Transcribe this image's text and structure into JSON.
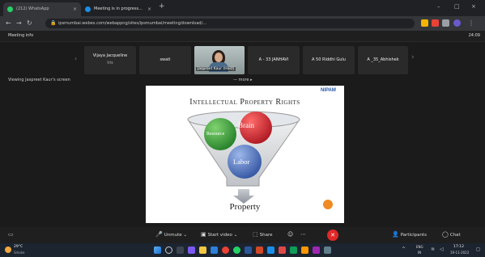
{
  "browser": {
    "tabs": [
      {
        "title": "(212) WhatsApp",
        "close": "×"
      },
      {
        "title": "Meeting is in progress...",
        "close": "×"
      }
    ],
    "new_tab": "+",
    "window_controls": {
      "minimize": "–",
      "maximize": "□",
      "close": "×"
    },
    "url": "ipsmumbai.webex.com/webappng/sites/ipsmumbai/meeting/download/..."
  },
  "meeting": {
    "info_label": "Meeting info",
    "time": "24:09",
    "participants": [
      {
        "name": "Vijaya Jacqueline",
        "sub": "Iris"
      },
      {
        "name": "swati",
        "sub": ""
      },
      {
        "name": "Jaspreet Kaur (Host)",
        "sub": ""
      },
      {
        "name": "A - 33 JANHAVI",
        "sub": ""
      },
      {
        "name": "A 50 Riddhi Gulu",
        "sub": ""
      },
      {
        "name": "A _35_Abhishek",
        "sub": ""
      }
    ],
    "viewing_label": "Viewing Jaspreet Kaur's screen",
    "view_options": "—  more  ▸"
  },
  "slide": {
    "logo": "NIPAM",
    "title": "Intellectual Property Rights",
    "bubbles": [
      {
        "label": "Brain",
        "color": "#c8202a"
      },
      {
        "label": "Resource",
        "color": "#2f9a33"
      },
      {
        "label": "Labor",
        "color": "#3b62b0"
      }
    ],
    "result": "Property"
  },
  "toolbar": {
    "unmute": "Unmute",
    "start_video": "Start video",
    "share": "Share",
    "participants": "Participants",
    "chat": "Chat"
  },
  "taskbar": {
    "weather_temp": "29°C",
    "weather_desc": "Smoke",
    "lang": "ENG",
    "lang_sub": "IN",
    "time": "17:12",
    "date": "19-11-2022"
  }
}
